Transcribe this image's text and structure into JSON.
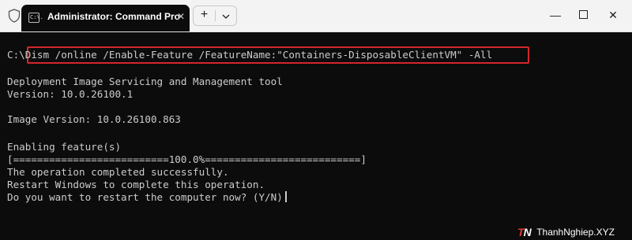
{
  "window": {
    "tab_title": "Administrator: Command Pro",
    "tab_icon": "cmd-icon",
    "tab_icon_text": "C:\\.",
    "close_tab_glyph": "✕",
    "new_tab_glyph": "+",
    "minimize_glyph": "—",
    "close_window_glyph": "✕"
  },
  "terminal": {
    "prompt": "C:\\",
    "command": "Dism /online /Enable-Feature /FeatureName:\"Containers-DisposableClientVM\" -All",
    "lines": [
      "Deployment Image Servicing and Management tool",
      "Version: 10.0.26100.1",
      "",
      "Image Version: 10.0.26100.863",
      "",
      "Enabling feature(s)",
      "[==========================100.0%==========================]",
      "The operation completed successfully.",
      "Restart Windows to complete this operation.",
      "Do you want to restart the computer now? (Y/N)"
    ],
    "progress": 1.0,
    "highlight_color": "#d4262c"
  },
  "watermark": {
    "logo_red": "T",
    "logo_white": "N",
    "text": "ThanhNghiep.XYZ"
  }
}
